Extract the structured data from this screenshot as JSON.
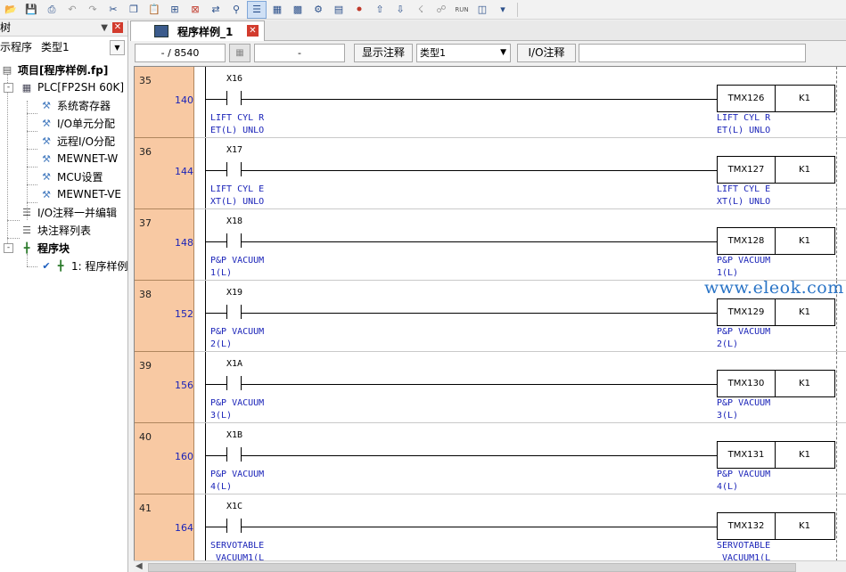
{
  "toolbar": {
    "buttons": [
      "open-icon",
      "save-icon",
      "print-icon",
      "undo-icon",
      "redo-icon",
      "cut-icon",
      "copy-icon",
      "paste-icon",
      "insert-row-icon",
      "delete-row-icon",
      "replace-icon",
      "find-icon",
      "list-view-icon",
      "ladder-view-icon",
      "boolean-view-icon",
      "compile-icon",
      "monitor-icon",
      "download-icon",
      "upload-icon",
      "online-icon",
      "offline-icon",
      "run-icon",
      "program-icon",
      "settings-icon"
    ],
    "run_label": "RUN"
  },
  "tree": {
    "title": "树",
    "filter_label": "示程序",
    "filter_value": "类型1",
    "project": "项目[程序样例.fp]",
    "plc": "PLC[FP2SH 60K]",
    "plc_items": [
      "系统寄存器",
      "I/O单元分配",
      "远程I/O分配",
      "MEWNET-W",
      "MCU设置",
      "MEWNET-VE"
    ],
    "io_comment": "I/O注释一并编辑",
    "block_comment": "块注释列表",
    "program_block": "程序块",
    "program_item": "1: 程序样例"
  },
  "doc": {
    "tab_label": "程序样例_1",
    "status": {
      "position": "- /  8540",
      "field2": "-",
      "show_comment_btn": "显示注释",
      "type_value": "类型1",
      "io_comment_btn": "I/O注释",
      "io_comment_value": ""
    }
  },
  "rungs": [
    {
      "no": "35",
      "addr": "140",
      "contact": "X16",
      "c1": "LIFT CYL R",
      "c2": "ET(L) UNLO",
      "timer": "TMX126",
      "k": "K1"
    },
    {
      "no": "36",
      "addr": "144",
      "contact": "X17",
      "c1": "LIFT CYL E",
      "c2": "XT(L) UNLO",
      "timer": "TMX127",
      "k": "K1"
    },
    {
      "no": "37",
      "addr": "148",
      "contact": "X18",
      "c1": "P&P VACUUM",
      "c2": "1(L)",
      "timer": "TMX128",
      "k": "K1"
    },
    {
      "no": "38",
      "addr": "152",
      "contact": "X19",
      "c1": "P&P VACUUM",
      "c2": "2(L)",
      "timer": "TMX129",
      "k": "K1"
    },
    {
      "no": "39",
      "addr": "156",
      "contact": "X1A",
      "c1": "P&P VACUUM",
      "c2": "3(L)",
      "timer": "TMX130",
      "k": "K1"
    },
    {
      "no": "40",
      "addr": "160",
      "contact": "X1B",
      "c1": "P&P VACUUM",
      "c2": "4(L)",
      "timer": "TMX131",
      "k": "K1"
    },
    {
      "no": "41",
      "addr": "164",
      "contact": "X1C",
      "c1": "SERVOTABLE",
      "c2": " VACUUM1(L",
      "timer": "TMX132",
      "k": "K1"
    }
  ],
  "watermark": "www.eleok.com"
}
